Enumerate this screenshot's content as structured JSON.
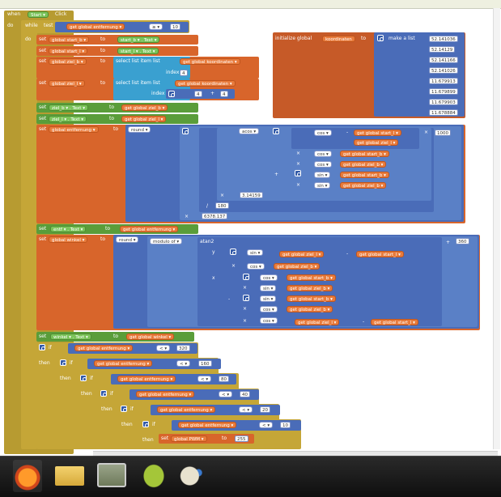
{
  "blocks": {
    "when": "when",
    "event_component": "Start",
    "event_name": "Click",
    "do": "do",
    "while": "while",
    "test": "test",
    "get": "get",
    "set": "set",
    "to": "to",
    "text": "Text",
    "global_entfernung": "global entfernung",
    "global_start_b": "global start_b",
    "global_start_l": "global start_l",
    "global_ziel_b": "global ziel_b",
    "global_ziel_l": "global ziel_l",
    "global_koordinaten": "global koordinaten",
    "global_winkel": "global winkel",
    "global_pwm": "global PWM",
    "start_b": "start_b",
    "start_l": "start_l",
    "ziel_b": "ziel_b",
    "ziel_l": "ziel_l",
    "entf": "entf",
    "winkel": "winkel",
    "gte": "≥",
    "lt": "<",
    "num10": "10",
    "num4": "4",
    "num4b": "4",
    "num4c": "4",
    "plus": "+",
    "minus": "-",
    "times": "×",
    "div": "/",
    "select_list_item": "select list item",
    "list": "list",
    "index": "index",
    "round": "round",
    "acos": "acos",
    "cos": "cos",
    "sin": "sin",
    "num1000": "1000",
    "num180": "180",
    "pi": "3.14159",
    "earth": "6378.137",
    "modulo_of": "modulo of",
    "atan2": "atan2",
    "y": "y",
    "x": "x",
    "num360": "360",
    "if": "if",
    "then": "then",
    "num320": "320",
    "num160": "160",
    "num80": "80",
    "num40": "40",
    "num20": "20",
    "num10b": "10",
    "num255": "255",
    "initialize_global": "initialize global",
    "koordinaten": "koordinaten",
    "make_a_list": "make a list",
    "coords": [
      "52.141036",
      "52.14129",
      "52.141166",
      "52.141026",
      "11.679913",
      "11.679899",
      "11.679903",
      "11.678884"
    ]
  },
  "taskbar": {
    "icons": [
      "firefox-icon",
      "folder-icon",
      "android-emulator-icon",
      "android-icon",
      "paint-icon"
    ]
  }
}
